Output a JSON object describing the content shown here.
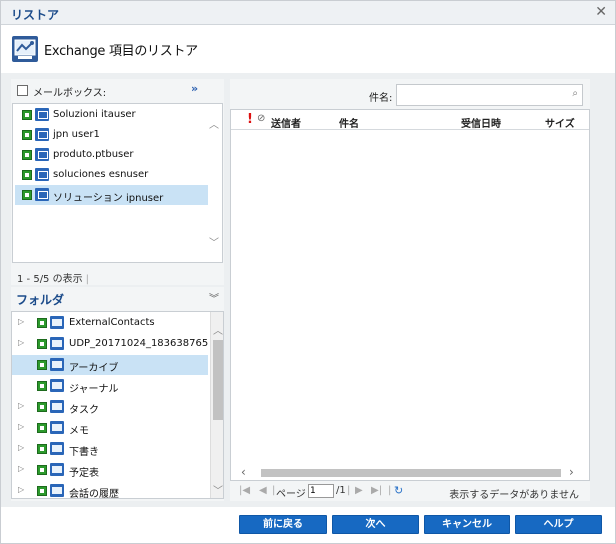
{
  "window": {
    "title": "リストア",
    "close_icon": "close-icon"
  },
  "header": {
    "title": "Exchange 項目のリストア",
    "icon": "exchange-restore-icon"
  },
  "mailbox_panel": {
    "label": "メールボックス:",
    "expand_icon": "double-chevron-right-icon",
    "items": [
      {
        "label": "Soluzioni itauser",
        "selected": false
      },
      {
        "label": "jpn user1",
        "selected": false
      },
      {
        "label": "produto.ptbuser",
        "selected": false
      },
      {
        "label": "soluciones esnuser",
        "selected": false
      },
      {
        "label": "ソリューション ipnuser",
        "selected": true
      }
    ],
    "pager_text": "1 - 5/5 の表示"
  },
  "folder_panel": {
    "title": "フォルダ",
    "collapse_icon": "double-chevron-down-icon",
    "items": [
      {
        "label": "ExternalContacts",
        "expandable": true,
        "selected": false
      },
      {
        "label": "UDP_20171024_183638765",
        "expandable": true,
        "selected": false
      },
      {
        "label": "アーカイブ",
        "expandable": false,
        "selected": true
      },
      {
        "label": "ジャーナル",
        "expandable": false,
        "selected": false
      },
      {
        "label": "タスク",
        "expandable": true,
        "selected": false
      },
      {
        "label": "メモ",
        "expandable": true,
        "selected": false
      },
      {
        "label": "下書き",
        "expandable": true,
        "selected": false
      },
      {
        "label": "予定表",
        "expandable": true,
        "selected": false
      },
      {
        "label": "会話の履歴",
        "expandable": true,
        "selected": false
      }
    ]
  },
  "search": {
    "label": "件名:",
    "value": "",
    "placeholder": ""
  },
  "grid": {
    "importance_mark": "!",
    "attachment_mark": "⊘",
    "columns": {
      "sender": "送信者",
      "subject": "件名",
      "received": "受信日時",
      "size": "サイズ"
    }
  },
  "pager": {
    "page_label": "ページ",
    "page_value": "1",
    "of_label": "/1",
    "status": "表示するデータがありません"
  },
  "buttons": {
    "back": "前に戻る",
    "next": "次へ",
    "cancel": "キャンセル",
    "help": "ヘルプ"
  },
  "colors": {
    "accent": "#1769c2",
    "title_text": "#1b4b8a",
    "selection": "#c9e2f5",
    "status_green": "#2c9a2c"
  }
}
